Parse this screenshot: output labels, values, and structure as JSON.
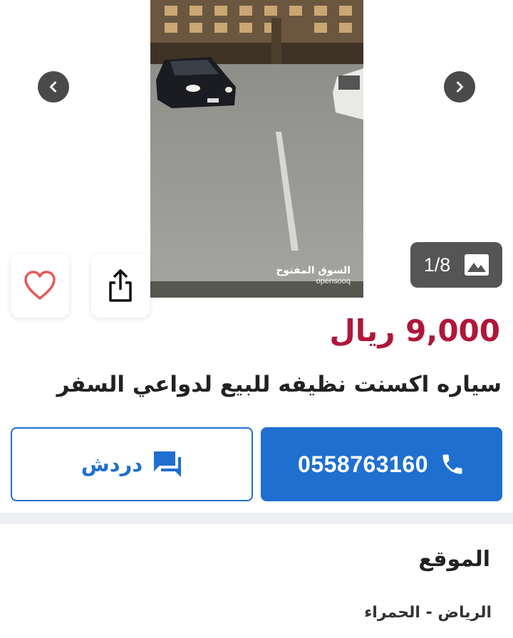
{
  "gallery": {
    "counter": "1/8",
    "watermark": {
      "arabic": "السوق المفتوح",
      "latin": "opensooq"
    },
    "icons": {
      "prev": "chevron-left-icon",
      "next": "chevron-right-icon",
      "photos": "image-icon",
      "favorite": "heart-icon",
      "share": "share-icon"
    }
  },
  "listing": {
    "price": "9,000 ريال",
    "title": "سياره اكسنت نظيفه للبيع لدواعي السفر"
  },
  "contact": {
    "phone_label": "0558763160",
    "chat_label": "دردش",
    "icons": {
      "phone": "phone-icon",
      "chat": "chat-icon"
    }
  },
  "location": {
    "heading": "الموقع",
    "value": "الرياض - الحمراء"
  },
  "colors": {
    "price": "#b0163a",
    "accent": "#1f6fd0",
    "heart": "#e85a5a"
  }
}
